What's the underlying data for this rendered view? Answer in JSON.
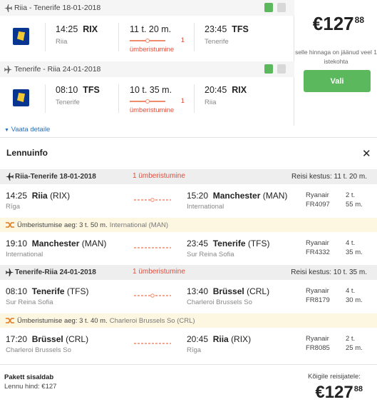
{
  "outbound": {
    "header": "Riia - Tenerife 18-01-2018",
    "dep_time": "14:25",
    "dep_code": "RIX",
    "dep_city": "Riia",
    "duration": "11 t. 20 m.",
    "stops_count": "1",
    "stops_label": "ümberistumine",
    "arr_time": "23:45",
    "arr_code": "TFS",
    "arr_city": "Tenerife"
  },
  "inbound": {
    "header": "Tenerife - Riia 24-01-2018",
    "dep_time": "08:10",
    "dep_code": "TFS",
    "dep_city": "Tenerife",
    "duration": "10 t. 35 m.",
    "stops_count": "1",
    "stops_label": "ümberistumine",
    "arr_time": "20:45",
    "arr_code": "RIX",
    "arr_city": "Riia"
  },
  "price": {
    "currency": "€",
    "main": "127",
    "cents": "88",
    "note": "selle hinnaga on jäänud veel 1 istekohta",
    "select_label": "Vali"
  },
  "details_link": "Vaata detaile",
  "flight_info": {
    "title": "Lennuinfo",
    "close_icon": "close-icon",
    "sections": [
      {
        "route": "Riia-Tenerife 18-01-2018",
        "stops": "1 ümberistumine",
        "duration": "Reisi kestus: 11 t. 20 m.",
        "segments": [
          {
            "dep_time": "14:25",
            "dep_name": "Riia",
            "dep_code": "(RIX)",
            "dep_sub": "Rīga",
            "arr_time": "15:20",
            "arr_name": "Manchester",
            "arr_code": "(MAN)",
            "arr_sub": "International",
            "airline": "Ryanair",
            "flight_no": "FR4097",
            "dur_h": "2 t.",
            "dur_m": "55 m."
          },
          {
            "dep_time": "19:10",
            "dep_name": "Manchester",
            "dep_code": "(MAN)",
            "dep_sub": "International",
            "arr_time": "23:45",
            "arr_name": "Tenerife",
            "arr_code": "(TFS)",
            "arr_sub": "Sur Reina Sofia",
            "airline": "Ryanair",
            "flight_no": "FR4332",
            "dur_h": "4 t.",
            "dur_m": "35 m."
          }
        ],
        "layover": {
          "text": "Ümberistumise aeg: 3 t. 50 m.",
          "airport": "International (MAN)"
        }
      },
      {
        "route": "Tenerife-Riia 24-01-2018",
        "stops": "1 ümberistumine",
        "duration": "Reisi kestus: 10 t. 35 m.",
        "segments": [
          {
            "dep_time": "08:10",
            "dep_name": "Tenerife",
            "dep_code": "(TFS)",
            "dep_sub": "Sur Reina Sofia",
            "arr_time": "13:40",
            "arr_name": "Brüssel",
            "arr_code": "(CRL)",
            "arr_sub": "Charleroi Brussels So",
            "airline": "Ryanair",
            "flight_no": "FR8179",
            "dur_h": "4 t.",
            "dur_m": "30 m."
          },
          {
            "dep_time": "17:20",
            "dep_name": "Brüssel",
            "dep_code": "(CRL)",
            "dep_sub": "Charleroi Brussels So",
            "arr_time": "20:45",
            "arr_name": "Riia",
            "arr_code": "(RIX)",
            "arr_sub": "Rīga",
            "airline": "Ryanair",
            "flight_no": "FR8085",
            "dur_h": "2 t.",
            "dur_m": "25 m."
          }
        ],
        "layover": {
          "text": "Ümberistumise aeg: 3 t. 40 m.",
          "airport": "Charleroi Brussels So (CRL)"
        }
      }
    ]
  },
  "footer": {
    "package_title": "Pakett sisaldab",
    "package_sub": "Lennu hind: €127",
    "all_travelers": "Kõigile reisijatele:"
  },
  "colors": {
    "accent_green": "#5cb85c",
    "stop_red": "#e24d3b",
    "layover_bg": "#fdf7e1",
    "ryanair_blue": "#073590"
  }
}
